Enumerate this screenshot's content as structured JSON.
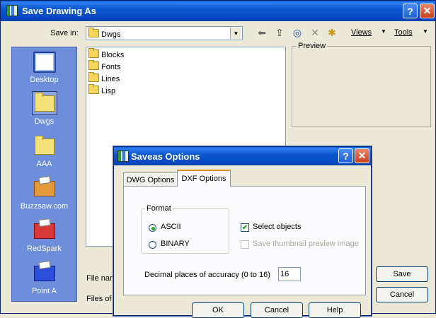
{
  "window": {
    "title": "Save Drawing As",
    "help_symbol": "?",
    "close_symbol": "✕"
  },
  "toolbar": {
    "save_in_label": "Save in:",
    "save_in_value": "Dwgs",
    "views_label": "Views",
    "tools_label": "Tools"
  },
  "places": [
    {
      "label": "Desktop"
    },
    {
      "label": "Dwgs"
    },
    {
      "label": "AAA"
    },
    {
      "label": "Buzzsaw.com"
    },
    {
      "label": "RedSpark"
    },
    {
      "label": "Point A"
    }
  ],
  "files": [
    "Blocks",
    "Fonts",
    "Lines",
    "Lisp"
  ],
  "preview": {
    "label": "Preview"
  },
  "bottom": {
    "file_name_label": "File nam",
    "files_type_label": "Files of",
    "save_label": "Save",
    "cancel_label": "Cancel"
  },
  "dialog": {
    "title": "Saveas Options",
    "help_symbol": "?",
    "close_symbol": "✕",
    "tabs": [
      {
        "label": "DWG Options",
        "active": false
      },
      {
        "label": "DXF Options",
        "active": true
      }
    ],
    "format_label": "Format",
    "format_options": [
      {
        "label": "ASCII",
        "selected": true
      },
      {
        "label": "BINARY",
        "selected": false
      }
    ],
    "select_objects_label": "Select objects",
    "select_objects_checked": true,
    "save_thumbnail_label": "Save thumbnail preview image",
    "save_thumbnail_checked": false,
    "decimal_label": "Decimal places of accuracy (0 to 16)",
    "decimal_value": "16",
    "ok_label": "OK",
    "cancel_label": "Cancel",
    "help_label": "Help"
  },
  "colors": {
    "titlebar": "#0b57d0",
    "places_bar": "#6e8edb",
    "dialog_bg": "#ece9d8",
    "tab_accent": "#e68b2c"
  }
}
